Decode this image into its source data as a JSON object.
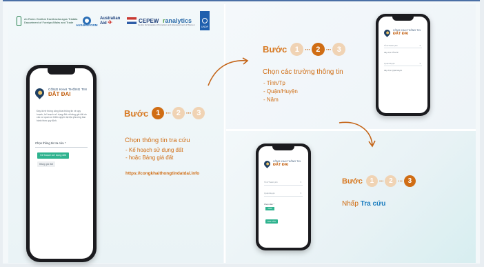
{
  "colors": {
    "accent_orange": "#d06d14",
    "accent_light": "#f0d3b4",
    "brand_navy": "#1e3f63",
    "button_green": "#2fb38f",
    "link_blue": "#1f7fc0"
  },
  "logos": {
    "ireland_l1": "An Roinn Gnóthaí Eachtracha agus Trádála",
    "ireland_l2": "Department of Foreign Affairs and Trade",
    "aus_reform_name": "AUS4REFORM",
    "aus_aid_l1": "Australian",
    "aus_aid_l2": "Aid",
    "cepew_name": "CEPEW",
    "cepew_sub": "Centre for Education Promotion and Empowerment of Women",
    "ranalytics_r": "r",
    "ranalytics_rest": "analytics",
    "undp_name": "UNDP"
  },
  "app": {
    "brand_line1": "CÔNG KHAI THÔNG TIN",
    "brand_line2": "ĐẤT ĐAI",
    "description": "Đây là hệ thống công khai thông tin về quy hoạch, kế hoạch sử dụng đất và bảng giá đất do các cơ quan có thẩm quyền tại địa phương ban hành theo quy định.",
    "lookup_label": "Chọn thông tin tra cứu *",
    "option_land_use_plan": "Kế hoạch sử dụng đất",
    "option_land_price": "Bảng giá đất",
    "select_city": "Tỉnh/Thành phố",
    "select_district": "Quận/Huyện",
    "sub_city": "Hãy chọn Tỉnh/TP",
    "sub_district": "Hãy chọn Quận/Huyện",
    "year_label": "Chọn năm *",
    "year_value": "2020",
    "submit": "TRA CỨU"
  },
  "step1": {
    "word": "Bước",
    "dots": [
      "1",
      "2",
      "3"
    ],
    "heading": "Chọn thông tin tra cứu",
    "items": [
      "- Kế hoạch sử dụng đất",
      "- hoặc Bảng giá đất"
    ],
    "link": "https://congkhaithongtindatdai.info"
  },
  "step2": {
    "word": "Bước",
    "dots": [
      "1",
      "2",
      "3"
    ],
    "heading": "Chọn các trường thông tin",
    "items": [
      "- Tỉnh/Tp",
      "- Quận/Huyện",
      "- Năm"
    ]
  },
  "step3": {
    "word": "Bước",
    "dots": [
      "1",
      "2",
      "3"
    ],
    "heading_plain": "Nhấp",
    "heading_emph": "Tra cứu"
  }
}
